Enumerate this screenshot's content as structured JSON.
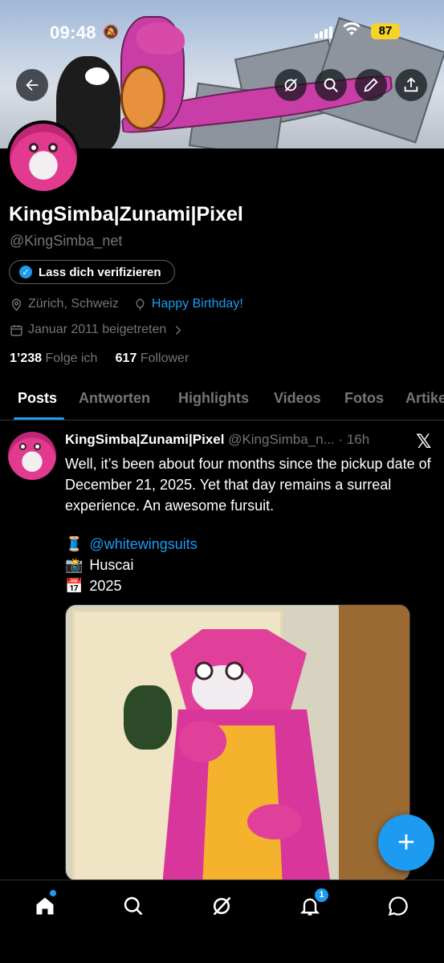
{
  "status": {
    "time": "09:48",
    "battery": "87"
  },
  "profile": {
    "display_name": "KingSimba|Zunami|Pixel",
    "handle": "@KingSimba_net",
    "verify_label": "Lass dich verifizieren",
    "location": "Zürich, Schweiz",
    "birthday": "Happy Birthday!",
    "joined": "Januar 2011 beigetreten",
    "following_count": "1’238",
    "following_label": "Folge ich",
    "followers_count": "617",
    "followers_label": "Follower"
  },
  "tabs": [
    "Posts",
    "Antworten",
    "Highlights",
    "Videos",
    "Fotos",
    "Artikel"
  ],
  "post": {
    "name": "KingSimba|Zunami|Pixel",
    "handle_time": "@KingSimba_n... · 16h",
    "text": "Well, it’s been about four months since the pickup date of December 21, 2025. Yet that day remains a surreal experience. An awesome fursuit.",
    "line1_emoji": "🧵",
    "line1_mention": "@whitewingsuits",
    "line2_emoji": "📸",
    "line2_text": "Huscai",
    "line3_emoji": "📅",
    "line3_text": "2025"
  },
  "notification_count": "1",
  "colors": {
    "accent": "#1d9bf0",
    "background": "#000000",
    "secondary_text": "#71767b"
  }
}
